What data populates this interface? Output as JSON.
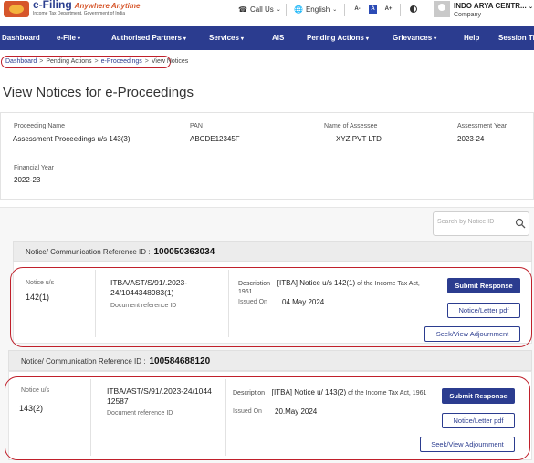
{
  "header": {
    "logo_title": "e-Filing",
    "logo_tagline": "Anywhere Anytime",
    "logo_sub": "Income Tax Department, Government of India",
    "call_us": "Call Us",
    "language": "English",
    "font_decrease": "A-",
    "font_normal": "A",
    "font_increase": "A+",
    "user_name": "INDO ARYA CENTR...",
    "user_role": "Company"
  },
  "nav": {
    "items": [
      "Dashboard",
      "e-File",
      "Authorised Partners",
      "Services",
      "AIS",
      "Pending Actions",
      "Grievances",
      "Help",
      "Session Time"
    ]
  },
  "breadcrumb": [
    "Dashboard",
    "Pending Actions",
    "e-Proceedings",
    "View Notices"
  ],
  "page_title": "View Notices for e-Proceedings",
  "proceeding": {
    "name_label": "Proceeding Name",
    "name_value": "Assessment Proceedings u/s 143(3)",
    "pan_label": "PAN",
    "pan_value": "ABCDE12345F",
    "assessee_label": "Name of Assessee",
    "assessee_value": "XYZ PVT LTD",
    "ay_label": "Assessment Year",
    "ay_value": "2023-24",
    "fy_label": "Financial Year",
    "fy_value": "2022-23"
  },
  "search": {
    "placeholder": "Search by Notice ID"
  },
  "notices": [
    {
      "header_label": "Notice/ Communication Reference ID :",
      "ref_id": "100050363034",
      "notice_us_label": "Notice u/s",
      "notice_us_value": "142(1)",
      "doc_ref_value": "ITBA/AST/S/91/.2023-24/1044348983(1)",
      "doc_ref_label": "Document reference ID",
      "desc_label": "Description",
      "desc_value": "[ITBA] Notice u/s 142(1)",
      "desc_suffix": "of the Income Tax Act, 1961",
      "issued_label": "Issued On",
      "issued_value": "04.May 2024",
      "submit_label": "Submit Response",
      "letter_label": "Notice/Letter pdf",
      "seek_label": "Seek/View Adjournment"
    },
    {
      "header_label": "Notice/ Communication Reference ID :",
      "ref_id": "100584688120",
      "notice_us_label": "Notice u/s",
      "notice_us_value": "143(2)",
      "doc_ref_value": "ITBA/AST/S/91/.2023-24/1044 12587",
      "doc_ref_label": "Document reference ID",
      "desc_label": "Description",
      "desc_value": "[ITBA] Notice u/ 143(2)",
      "desc_suffix": "of the Income Tax Act, 1961",
      "issued_label": "Issued On",
      "issued_value": "20.May 2024",
      "submit_label": "Submit Response",
      "letter_label": "Notice/Letter pdf",
      "seek_label": "Seek/View Adjournment"
    }
  ],
  "colors": {
    "nav_bg": "#2b3c8f",
    "primary_button": "#2b3c8f",
    "annotation": "#c0202b"
  }
}
